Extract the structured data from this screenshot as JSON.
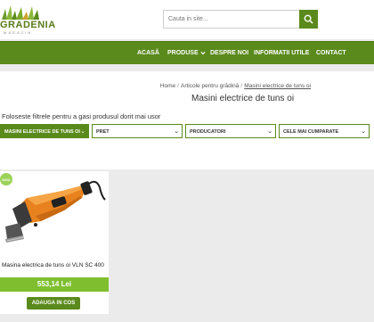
{
  "brand": {
    "logo_text": "GRADENIA",
    "logo_sub": "MAGAZIN"
  },
  "search": {
    "placeholder": "Cauta in site..."
  },
  "nav": {
    "items": [
      "ACASĂ",
      "PRODUSE",
      "DESPRE NOI",
      "INFORMATII UTILE",
      "CONTACT"
    ]
  },
  "breadcrumb": {
    "items": [
      "Home",
      "Articole pentru grădină",
      "Masini electrice de tuns oi"
    ]
  },
  "page": {
    "title": "Masini electrice de tuns oi",
    "filter_hint": "Foloseste filtrele pentru a gasi produsul dorit mai usor"
  },
  "filters": [
    {
      "label": "MASINI ELECTRICE DE TUNS OI",
      "active": true
    },
    {
      "label": "PRET",
      "active": false
    },
    {
      "label": "PRODUCATORI",
      "active": false
    },
    {
      "label": "CELE MAI CUMPARATE",
      "active": false
    }
  ],
  "product": {
    "badge": "NOU",
    "name": "Masina electrica de tuns oi VLN SC 400",
    "price": "553,14 Lei",
    "add_label": "ADAUGA IN COS"
  },
  "colors": {
    "brand_green": "#5a8a1c",
    "price_green": "#7fbf2f",
    "badge_green": "#9bd35a",
    "product_orange": "#e8821e"
  }
}
